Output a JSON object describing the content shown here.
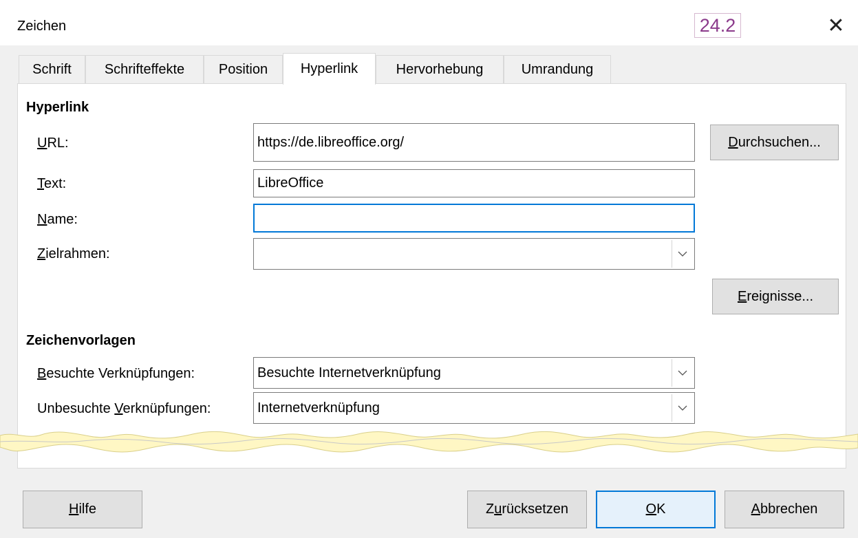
{
  "window": {
    "title": "Zeichen",
    "version_badge": "24.2",
    "close_glyph": "✕"
  },
  "tabs": [
    {
      "label": "Schrift",
      "active": false
    },
    {
      "label": "Schrifteffekte",
      "active": false
    },
    {
      "label": "Position",
      "active": false
    },
    {
      "label": "Hyperlink",
      "active": true
    },
    {
      "label": "Hervorhebung",
      "active": false
    },
    {
      "label": "Umrandung",
      "active": false
    }
  ],
  "hyperlink": {
    "heading": "Hyperlink",
    "url_label_mnemonic": "U",
    "url_label_rest": "RL:",
    "url_value": "https://de.libreoffice.org/",
    "browse_button_mnemonic": "D",
    "browse_button_rest": "urchsuchen...",
    "text_label_mnemonic": "T",
    "text_label_rest": "ext:",
    "text_value": "LibreOffice",
    "name_label_mnemonic": "N",
    "name_label_rest": "ame:",
    "name_value": "",
    "target_label_mnemonic": "Z",
    "target_label_rest": "ielrahmen:",
    "target_value": "",
    "events_button_mnemonic": "E",
    "events_button_rest": "reignisse..."
  },
  "character_styles": {
    "heading": "Zeichenvorlagen",
    "visited_label_mnemonic": "B",
    "visited_label_rest": "esuchte Verknüpfungen:",
    "visited_value": "Besuchte Internetverknüpfung",
    "unvisited_label_prefix": "Unbesuchte ",
    "unvisited_label_mnemonic": "V",
    "unvisited_label_rest": "erknüpfungen:",
    "unvisited_value": "Internetverknüpfung"
  },
  "footer": {
    "help_mnemonic": "H",
    "help_rest": "ilfe",
    "reset_prefix": "Z",
    "reset_mnemonic": "u",
    "reset_rest": "rücksetzen",
    "ok_mnemonic": "O",
    "ok_rest": "K",
    "cancel_mnemonic": "A",
    "cancel_rest": "bbrechen"
  },
  "colors": {
    "accent": "#0078d7",
    "badge_text": "#8b3a8b",
    "torn_edge": "#fff7c4"
  },
  "icons": {
    "close": "close-icon",
    "dropdown": "chevron-down-icon"
  }
}
